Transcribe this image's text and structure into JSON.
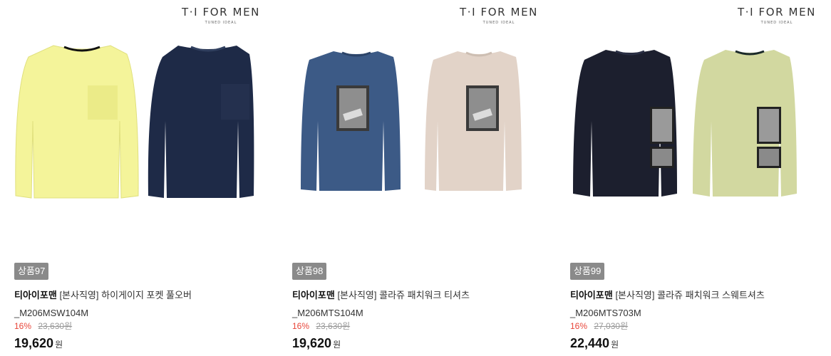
{
  "products": [
    {
      "brand_logo": {
        "name": "T·I FOR MEN",
        "tagline": "TUNED IDEAL"
      },
      "badge": "상품97",
      "shop": "티아이포맨",
      "title_rest": "[본사직영] 하이게이지 포켓 풀오버",
      "title_line2": "_M206MSW104M",
      "discount": "16%",
      "original_price": "23,630원",
      "price": "19,620",
      "currency": "원",
      "colors": [
        "#f2f28e",
        "#1e2a47"
      ]
    },
    {
      "brand_logo": {
        "name": "T·I FOR MEN",
        "tagline": "TUNED IDEAL"
      },
      "badge": "상품98",
      "shop": "티아이포맨",
      "title_rest": "[본사직영] 콜라쥬 패치워크 티셔츠",
      "title_line2": "_M206MTS104M",
      "discount": "16%",
      "original_price": "23,630원",
      "price": "19,620",
      "currency": "원",
      "colors": [
        "#3c5a86",
        "#e2d3c8"
      ]
    },
    {
      "brand_logo": {
        "name": "T·I FOR MEN",
        "tagline": "TUNED IDEAL"
      },
      "badge": "상품99",
      "shop": "티아이포맨",
      "title_rest": "[본사직영] 콜라쥬 패치워크 스웨트셔츠",
      "title_line2": "_M206MTS703M",
      "discount": "16%",
      "original_price": "27,030원",
      "price": "22,440",
      "currency": "원",
      "colors": [
        "#1c1f2e",
        "#d2d8a0"
      ]
    }
  ]
}
